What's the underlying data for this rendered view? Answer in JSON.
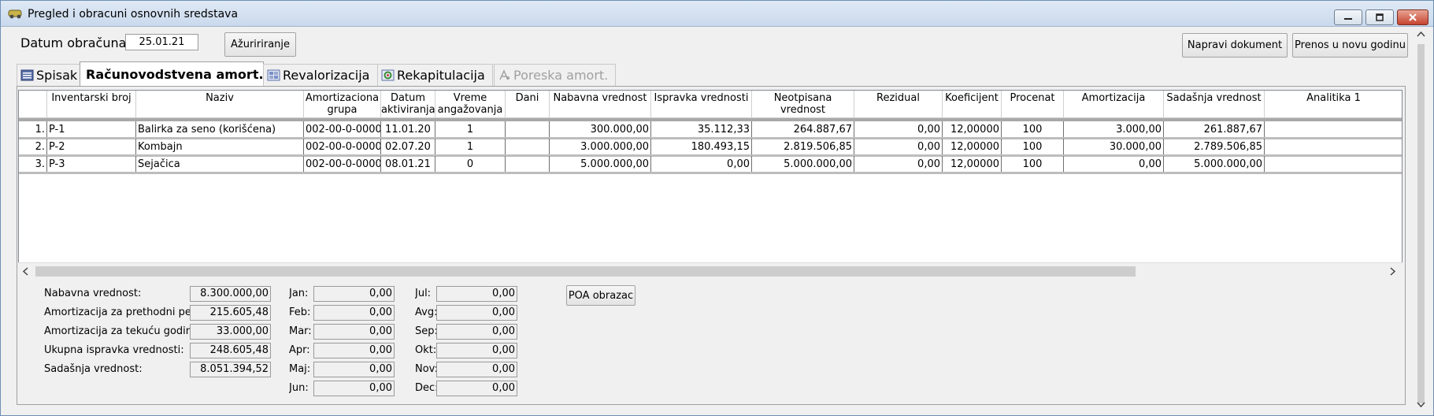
{
  "window": {
    "title": "Pregled i obracuni osnovnih sredstava"
  },
  "toolbar": {
    "date_label": "Datum obračuna:",
    "date_value": "25.01.21",
    "refresh_label": "Ažuririranje",
    "make_document_label": "Napravi dokument",
    "transfer_label": "Prenos u novu godinu"
  },
  "tabs": [
    {
      "label": "Spisak",
      "icon": "list-icon"
    },
    {
      "label": "Računovodstvena amort.",
      "icon": "accounting-icon"
    },
    {
      "label": "Revalorizacija",
      "icon": "revaluation-icon"
    },
    {
      "label": "Rekapitulacija",
      "icon": "recap-icon"
    },
    {
      "label": "Poreska amort.",
      "icon": "tax-icon"
    }
  ],
  "grid": {
    "columns": [
      "",
      "Inventarski broj",
      "Naziv",
      "Amortizaciona grupa",
      "Datum aktiviranja",
      "Vreme angažovanja",
      "Dani",
      "Nabavna vrednost",
      "Ispravka vrednosti",
      "Neotpisana vrednost",
      "Rezidual",
      "Koeficijent",
      "Procenat",
      "Amortizacija",
      "Sadašnja vrednost",
      "Analitika 1"
    ],
    "rows": [
      [
        "1.",
        "P-1",
        "Balirka za seno (korišćena)",
        "002-00-0-0000",
        "11.01.20",
        "1",
        "",
        "300.000,00",
        "35.112,33",
        "264.887,67",
        "0,00",
        "12,00000",
        "100",
        "3.000,00",
        "261.887,67",
        ""
      ],
      [
        "2.",
        "P-2",
        "Kombajn",
        "002-00-0-0000",
        "02.07.20",
        "1",
        "",
        "3.000.000,00",
        "180.493,15",
        "2.819.506,85",
        "0,00",
        "12,00000",
        "100",
        "30.000,00",
        "2.789.506,85",
        ""
      ],
      [
        "3.",
        "P-3",
        "Sejačica",
        "002-00-0-0000",
        "08.01.21",
        "0",
        "",
        "5.000.000,00",
        "0,00",
        "5.000.000,00",
        "0,00",
        "12,00000",
        "100",
        "0,00",
        "5.000.000,00",
        ""
      ]
    ]
  },
  "summary": {
    "items": [
      {
        "label": "Nabavna vrednost:",
        "value": "8.300.000,00"
      },
      {
        "label": "Amortizacija za prethodni period",
        "value": "215.605,48"
      },
      {
        "label": "Amortizacija za tekuću godinu:",
        "value": "33.000,00"
      },
      {
        "label": "Ukupna ispravka vrednosti:",
        "value": "248.605,48"
      },
      {
        "label": "Sadašnja vrednost:",
        "value": "8.051.394,52"
      }
    ]
  },
  "months_left": [
    {
      "label": "Jan:",
      "value": "0,00"
    },
    {
      "label": "Feb:",
      "value": "0,00"
    },
    {
      "label": "Mar:",
      "value": "0,00"
    },
    {
      "label": "Apr:",
      "value": "0,00"
    },
    {
      "label": "Maj:",
      "value": "0,00"
    },
    {
      "label": "Jun:",
      "value": "0,00"
    }
  ],
  "months_right": [
    {
      "label": "Jul:",
      "value": "0,00"
    },
    {
      "label": "Avg:",
      "value": "0,00"
    },
    {
      "label": "Sep:",
      "value": "0,00"
    },
    {
      "label": "Okt:",
      "value": "0,00"
    },
    {
      "label": "Nov:",
      "value": "0,00"
    },
    {
      "label": "Dec:",
      "value": "0,00"
    }
  ],
  "poa_label": "POA obrazac",
  "colors": {
    "titlebar": "#c9d9ec",
    "close": "#c54430",
    "accent": "#6d8fb5"
  }
}
